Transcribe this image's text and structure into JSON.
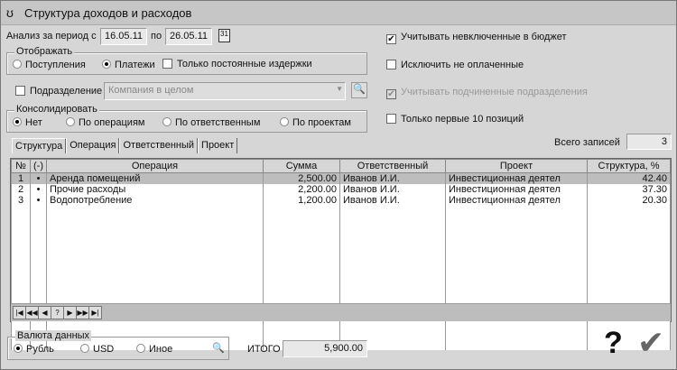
{
  "window": {
    "title": "Структура доходов и расходов"
  },
  "period": {
    "label": "Анализ за период с",
    "from": "16.05.11",
    "to_label": "по",
    "to": "26.05.11"
  },
  "display": {
    "label": "Отображать",
    "options": [
      {
        "label": "Поступления",
        "selected": false
      },
      {
        "label": "Платежи",
        "selected": true
      }
    ],
    "fixed_costs": {
      "label": "Только постоянные издержки",
      "checked": false
    }
  },
  "division": {
    "label": "Подразделение",
    "checked": false,
    "value": "Компания в целом"
  },
  "consolidate": {
    "label": "Консолидировать",
    "options": [
      {
        "label": "Нет",
        "selected": true
      },
      {
        "label": "По операциям",
        "selected": false
      },
      {
        "label": "По ответственным",
        "selected": false
      },
      {
        "label": "По проектам",
        "selected": false
      }
    ]
  },
  "right_options": [
    {
      "label": "Учитывать невключенные в бюджет",
      "checked": true,
      "disabled": false
    },
    {
      "label": "Исключить не оплаченные",
      "checked": false,
      "disabled": false
    },
    {
      "label": "Учитывать подчиненные подразделения",
      "checked": true,
      "disabled": true
    },
    {
      "label": "Только первые 10 позиций",
      "checked": false,
      "disabled": false
    }
  ],
  "tabs": [
    "Структура",
    "Операция",
    "Ответственный",
    "Проект"
  ],
  "records": {
    "label": "Всего записей",
    "count": "3"
  },
  "grid": {
    "columns": [
      "№",
      "(-)",
      "Операция",
      "Сумма",
      "Ответственный",
      "Проект",
      "Структура, %"
    ],
    "rows": [
      [
        "1",
        "•",
        "Аренда помещений",
        "2,500.00",
        "Иванов И.И.",
        "Инвестиционная деятел",
        "42.40"
      ],
      [
        "2",
        "•",
        "Прочие расходы",
        "2,200.00",
        "Иванов И.И.",
        "Инвестиционная деятел",
        "37.30"
      ],
      [
        "3",
        "•",
        "Водопотребление",
        "1,200.00",
        "Иванов И.И.",
        "Инвестиционная деятел",
        "20.30"
      ]
    ]
  },
  "nav": [
    "|◀",
    "◀◀",
    "◀",
    "?",
    "▶",
    "▶▶",
    "▶|"
  ],
  "currency": {
    "label": "Валюта данных",
    "options": [
      {
        "label": "Рубль",
        "selected": true
      },
      {
        "label": "USD",
        "selected": false
      },
      {
        "label": "Иное",
        "selected": false
      }
    ]
  },
  "total": {
    "label": "ИТОГО",
    "value": "5,900.00"
  }
}
